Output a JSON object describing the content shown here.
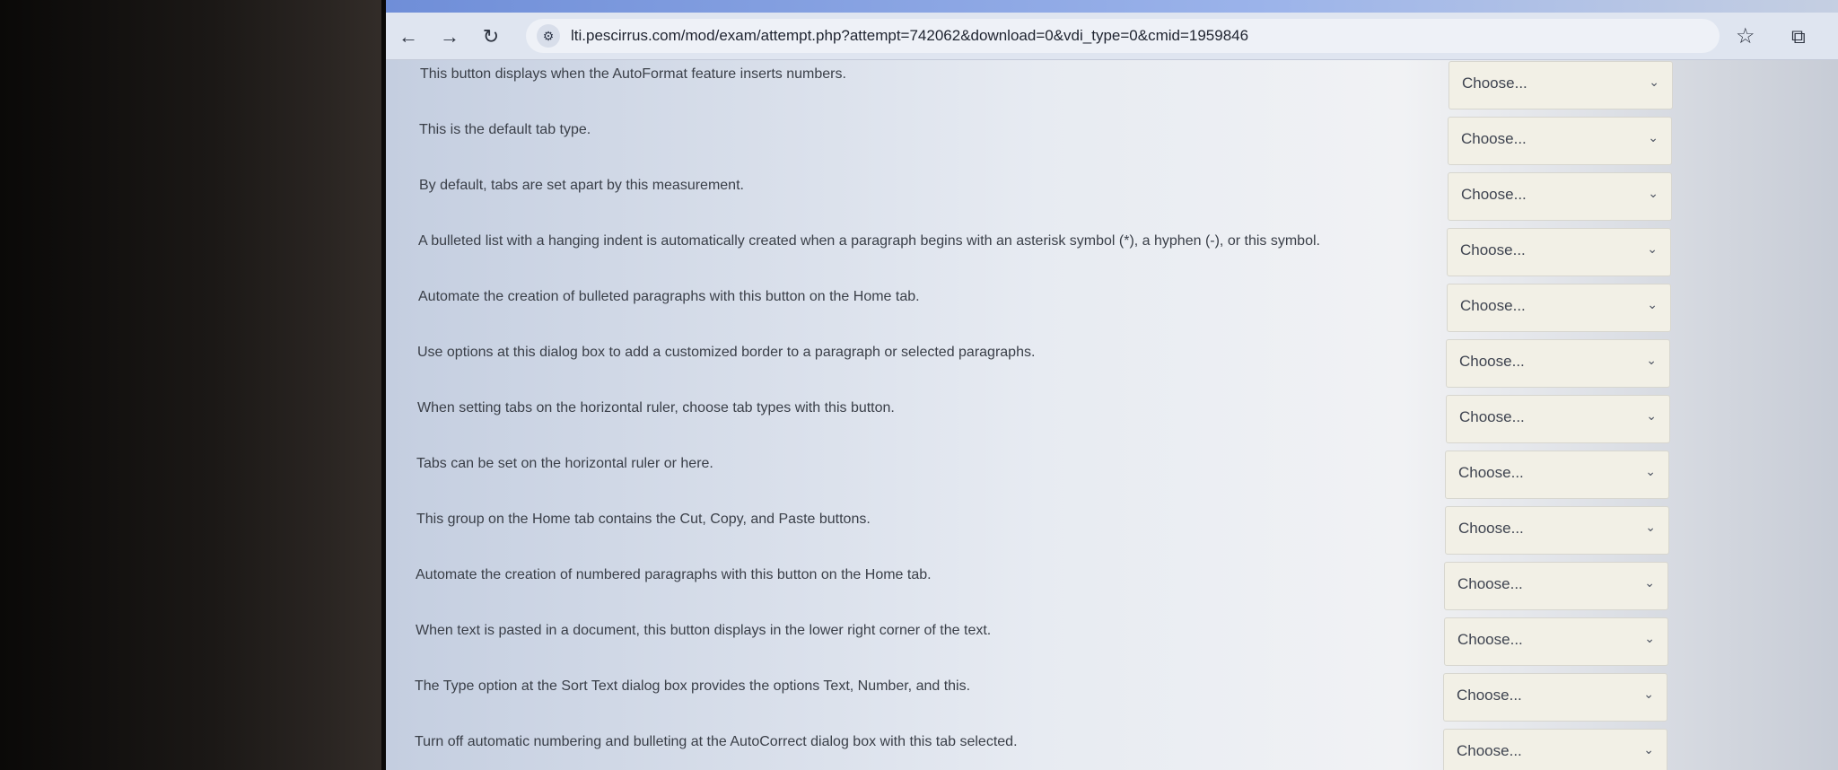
{
  "browser": {
    "back_icon": "arrow-left-icon",
    "forward_icon": "arrow-right-icon",
    "reload_icon": "reload-icon",
    "site_info_icon": "tune-icon",
    "url": "lti.pescirrus.com/mod/exam/attempt.php?attempt=742062&download=0&vdi_type=0&cmid=1959846",
    "bookmark_icon": "star-icon",
    "extension_icon": "puzzle-icon"
  },
  "questions": [
    {
      "text": "This button displays when the AutoFormat feature inserts numbers.",
      "answer": "Choose..."
    },
    {
      "text": "This is the default tab type.",
      "answer": "Choose..."
    },
    {
      "text": "By default, tabs are set apart by this measurement.",
      "answer": "Choose..."
    },
    {
      "text": "A bulleted list with a hanging indent is automatically created when a paragraph begins with an asterisk symbol (*), a hyphen (-), or this symbol.",
      "answer": "Choose..."
    },
    {
      "text": "Automate the creation of bulleted paragraphs with this button on the Home tab.",
      "answer": "Choose..."
    },
    {
      "text": "Use options at this dialog box to add a customized border to a paragraph or selected paragraphs.",
      "answer": "Choose..."
    },
    {
      "text": "When setting tabs on the horizontal ruler, choose tab types with this button.",
      "answer": "Choose..."
    },
    {
      "text": "Tabs can be set on the horizontal ruler or here.",
      "answer": "Choose..."
    },
    {
      "text": "This group on the Home tab contains the Cut, Copy, and Paste buttons.",
      "answer": "Choose..."
    },
    {
      "text": "Automate the creation of numbered paragraphs with this button on the Home tab.",
      "answer": "Choose..."
    },
    {
      "text": "When text is pasted in a document, this button displays in the lower right corner of the text.",
      "answer": "Choose..."
    },
    {
      "text": "The Type option at the Sort Text dialog box provides the options Text, Number, and this.",
      "answer": "Choose..."
    },
    {
      "text": "Turn off automatic numbering and bulleting at the AutoCorrect dialog box with this tab selected.",
      "answer": "Choose..."
    }
  ]
}
